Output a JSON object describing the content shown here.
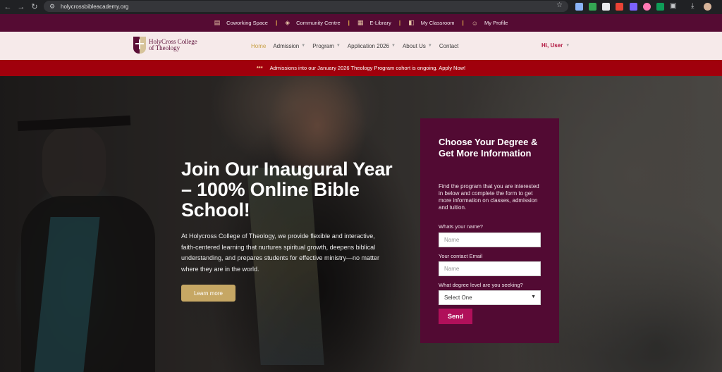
{
  "browser": {
    "url": "holycrossbibleacademy.org",
    "back_icon": "back-arrow-icon",
    "forward_icon": "forward-arrow-icon",
    "reload_icon": "reload-icon"
  },
  "topbar": {
    "items": [
      {
        "label": "Coworking Space",
        "icon": "building-icon"
      },
      {
        "label": "Community Centre",
        "icon": "megaphone-icon"
      },
      {
        "label": "E-Library",
        "icon": "book-icon"
      },
      {
        "label": "My Classroom",
        "icon": "open-book-icon"
      },
      {
        "label": "My Profile",
        "icon": "users-icon"
      }
    ],
    "separator": "|"
  },
  "header": {
    "logo_line1": "HolyCross College",
    "logo_line2": "of Theology",
    "menu": [
      {
        "label": "Home",
        "active": true,
        "dropdown": false
      },
      {
        "label": "Admission",
        "active": false,
        "dropdown": true
      },
      {
        "label": "Program",
        "active": false,
        "dropdown": true
      },
      {
        "label": "Application 2026",
        "active": false,
        "dropdown": true
      },
      {
        "label": "About Us",
        "active": false,
        "dropdown": true
      },
      {
        "label": "Contact",
        "active": false,
        "dropdown": false
      }
    ],
    "user_greeting": "Hi, User"
  },
  "announcement": {
    "stars": "***",
    "text": "Admissions into our January 2026 Theology Program cohort is ongoing. Apply Now!"
  },
  "hero": {
    "title": "Join Our Inaugural Year – 100% Online Bible School!",
    "body": "At Holycross College of Theology, we provide flexible and interactive, faith-centered learning that nurtures spiritual growth, deepens biblical understanding, and prepares students for effective ministry—no matter where they are in the world.",
    "cta_label": "Learn more"
  },
  "form": {
    "title": "Choose Your Degree & Get More Information",
    "description": "Find the program that you are interested in below and complete the form to get more information on classes, admission and tuition.",
    "name_label": "Whats your name?",
    "name_placeholder": "Name",
    "email_label": "Your contact Email",
    "email_placeholder": "Name",
    "degree_label": "What degree level are you seeking?",
    "degree_selected": "Select One",
    "submit_label": "Send"
  },
  "colors": {
    "topbar_bg": "#550b33",
    "nav_bg": "#f6eaea",
    "announce_bg": "#a0000c",
    "form_bg": "#520a33",
    "accent_gold": "#c6a764",
    "send_btn": "#b0105a"
  }
}
